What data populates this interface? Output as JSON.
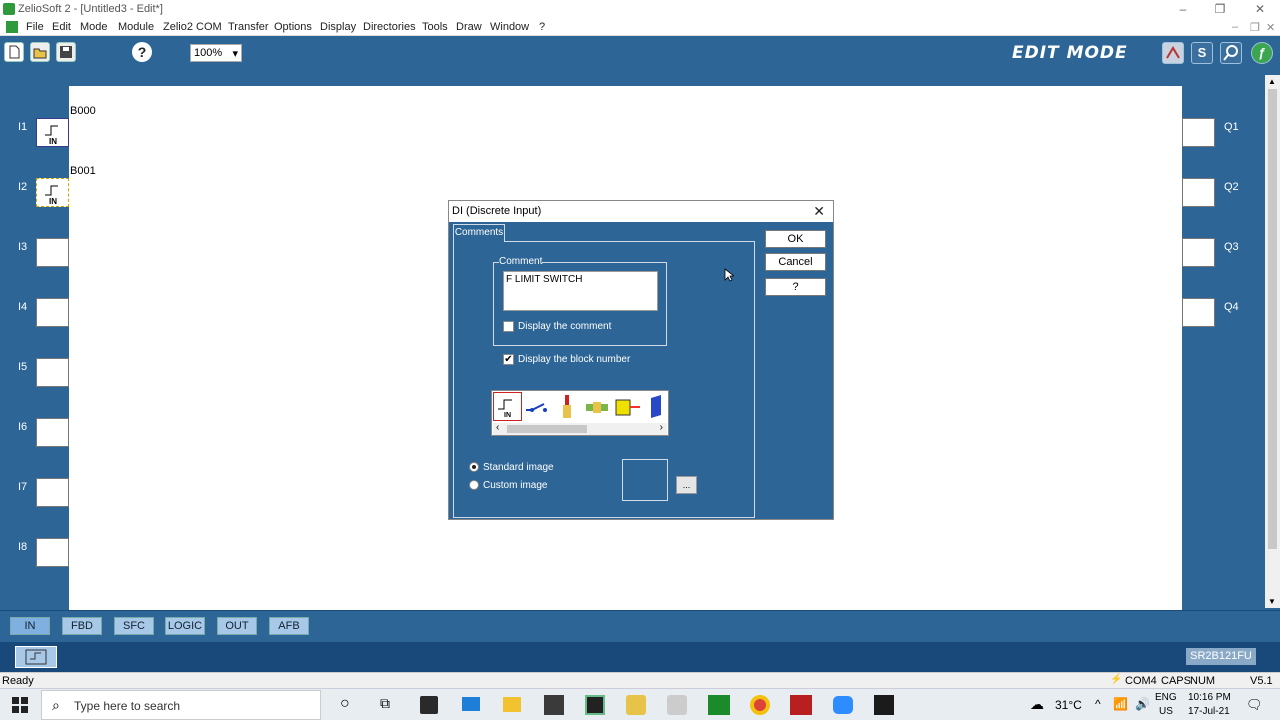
{
  "window": {
    "title": "ZelioSoft 2 - [Untitled3 - Edit*]"
  },
  "menu": [
    "File",
    "Edit",
    "Mode",
    "Module",
    "Zelio2 COM",
    "Transfer",
    "Options",
    "Display",
    "Directories",
    "Tools",
    "Draw",
    "Window",
    "?"
  ],
  "toolbar": {
    "zoom": "100%",
    "mode_label": "EDIT MODE",
    "s_button": "S"
  },
  "inputs": [
    {
      "label": "I1",
      "block": "B000"
    },
    {
      "label": "I2",
      "block": "B001"
    },
    {
      "label": "I3"
    },
    {
      "label": "I4"
    },
    {
      "label": "I5"
    },
    {
      "label": "I6"
    },
    {
      "label": "I7"
    },
    {
      "label": "I8"
    }
  ],
  "block_icon_text": "IN",
  "outputs": [
    "Q1",
    "Q2",
    "Q3",
    "Q4"
  ],
  "tabs": [
    "IN",
    "FBD",
    "SFC",
    "LOGIC",
    "OUT",
    "AFB"
  ],
  "model": "SR2B121FU",
  "status": {
    "left": "Ready",
    "com": "COM4",
    "caps": "CAPS",
    "num": "NUM",
    "version": "V5.1"
  },
  "dialog": {
    "title": "DI (Discrete Input)",
    "tab": "Comments",
    "comment_group": "Comment",
    "comment_value": "F LIMIT SWITCH",
    "display_comment": "Display the comment",
    "display_block_number": "Display the block number",
    "standard_image": "Standard image",
    "custom_image": "Custom image",
    "browse": "...",
    "ok": "OK",
    "cancel": "Cancel",
    "help": "?"
  },
  "taskbar": {
    "search_placeholder": "Type here to search",
    "temperature": "31°C",
    "lang": "ENG",
    "region": "US",
    "time": "10:16 PM",
    "date": "17-Jul-21"
  }
}
